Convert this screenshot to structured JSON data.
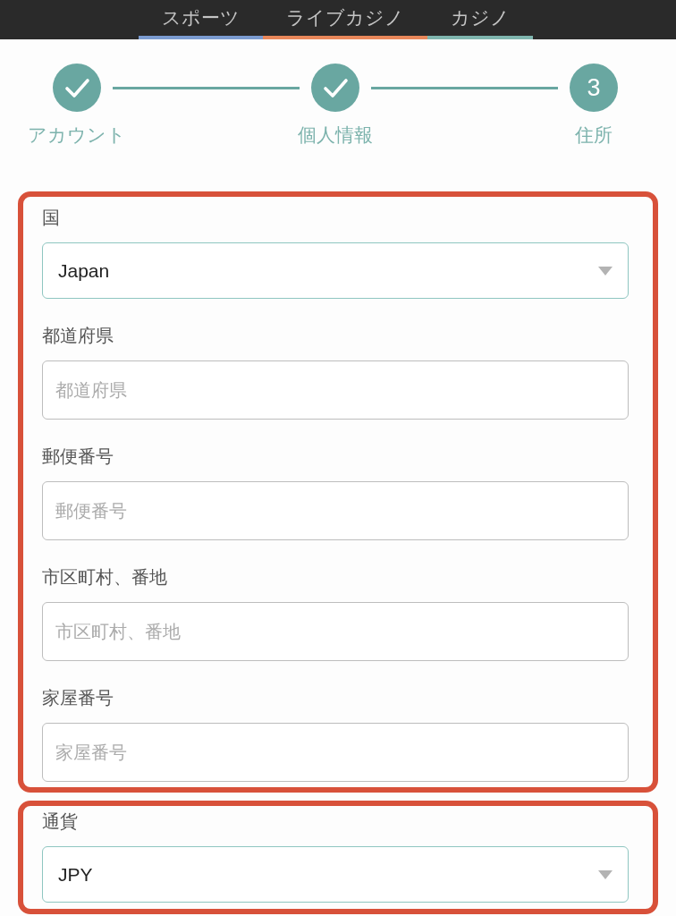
{
  "tabs": [
    {
      "label": "スポーツ",
      "color": "#7b9bd0"
    },
    {
      "label": "ライブカジノ",
      "color": "#e8875a"
    },
    {
      "label": "カジノ",
      "color": "#7fb5ae"
    }
  ],
  "steps": [
    {
      "label": "アカウント",
      "completed": true
    },
    {
      "label": "個人情報",
      "completed": true
    },
    {
      "label": "住所",
      "completed": false,
      "number": "3"
    }
  ],
  "sections": [
    {
      "highlighted": true,
      "fields": [
        {
          "kind": "select",
          "label": "国",
          "value": "Japan"
        },
        {
          "kind": "text",
          "label": "都道府県",
          "placeholder": "都道府県"
        },
        {
          "kind": "text",
          "label": "郵便番号",
          "placeholder": "郵便番号"
        },
        {
          "kind": "text",
          "label": "市区町村、番地",
          "placeholder": "市区町村、番地"
        },
        {
          "kind": "text",
          "label": "家屋番号",
          "placeholder": "家屋番号"
        }
      ]
    },
    {
      "highlighted": true,
      "fields": [
        {
          "kind": "select",
          "label": "通貨",
          "value": "JPY"
        }
      ]
    }
  ]
}
